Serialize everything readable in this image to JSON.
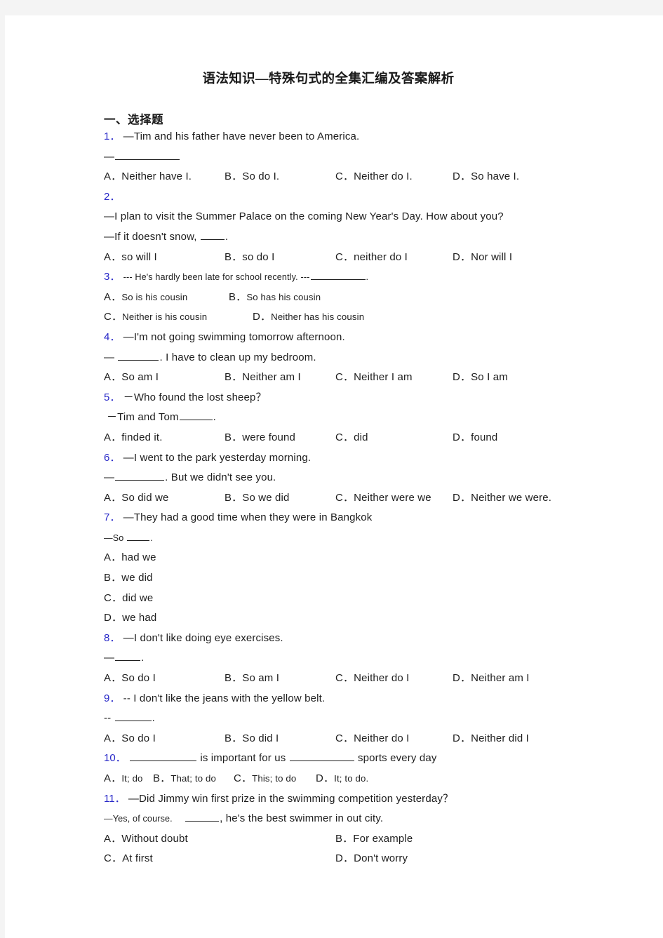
{
  "document": {
    "title": "语法知识—特殊句式的全集汇编及答案解析",
    "section_heading": "一、选择题"
  },
  "questions": [
    {
      "number": "1．",
      "stem": "—Tim and his father have never been to America.",
      "stem2_prefix": "—",
      "stem2_suffix": "",
      "options": [
        "A．Neither have I.",
        "B．So do I.",
        "C．Neither do I.",
        "D．So have I."
      ]
    },
    {
      "number": "2．",
      "line_a": "—I plan to visit the Summer Palace on the coming New Year's Day. How about you?",
      "line_b_prefix": "—If it doesn't snow, ",
      "line_b_suffix": ".",
      "options": [
        "A．so will I",
        "B．so do I",
        "C．neither do I",
        "D．Nor will I"
      ]
    },
    {
      "number": "3．",
      "stem_prefix": "--- He's hardly been late for school recently.    ---",
      "stem_suffix": ".",
      "options_row1": [
        "A．",
        "So is his cousin",
        "B．",
        "So has his cousin"
      ],
      "options_row2": [
        "C．",
        "Neither is his cousin",
        "D．",
        "Neither has his cousin"
      ]
    },
    {
      "number": "4．",
      "line_a": "—I'm not going swimming tomorrow afternoon.",
      "line_b_prefix": "— ",
      "line_b_suffix": ". I have to clean up my bedroom.",
      "options": [
        "A．So am I",
        "B．Neither am I",
        "C．Neither I am",
        "D．So I am"
      ]
    },
    {
      "number": "5．",
      "line_a": "－Who found the lost sheep？",
      "line_b_prefix": "－Tim and Tom",
      "line_b_suffix": ".",
      "options": [
        "A．finded it.",
        "B．were found",
        "C．did",
        "D．found"
      ]
    },
    {
      "number": "6．",
      "line_a": "—I went to the park yesterday morning.",
      "line_b_prefix": "—",
      "line_b_suffix": ". But we didn't see you.",
      "options": [
        "A．So did we",
        "B．So we did",
        "C．Neither were we",
        "D．Neither we were."
      ]
    },
    {
      "number": "7．",
      "line_a": "—They had a good time when they were in Bangkok",
      "line_b_prefix": "—So ",
      "line_b_suffix": ".",
      "stacked_options": [
        "A．had we",
        "B．we did",
        "C．did we",
        "D．we had"
      ]
    },
    {
      "number": "8．",
      "line_a": "—I don't like doing eye exercises.",
      "line_b_prefix": "—",
      "line_b_suffix": ".",
      "options": [
        "A．So do I",
        "B．So am I",
        "C．Neither do I",
        "D．Neither am I"
      ]
    },
    {
      "number": "9．",
      "line_a": "-- I don't like the jeans with the yellow belt.",
      "line_b_prefix": "-- ",
      "line_b_suffix": ".",
      "options": [
        "A．So do I",
        "B．So did I",
        "C．Neither do I",
        "D．Neither did I"
      ]
    },
    {
      "number": "10．",
      "stem_part1": " is important for us ",
      "stem_part2": " sports every day",
      "options": [
        "A．",
        "It; do",
        "B．",
        "That; to do",
        "C．",
        "This; to do",
        "D．",
        "It; to do."
      ]
    },
    {
      "number": "11．",
      "line_a": "—Did Jimmy win first prize in the swimming competition yesterday？",
      "line_b_prefix": "—Yes, of course.",
      "line_b_mid": "",
      "line_b_suffix": ", he's the best swimmer in out city.",
      "options_row1": [
        "A．Without doubt",
        "B．For example"
      ],
      "options_row2": [
        "C．At first",
        "D．Don't worry"
      ]
    }
  ],
  "colors": {
    "question_number": "#2828c8",
    "body_text": "#1d1d1d",
    "page_background": "#ffffff",
    "outer_background": "#f4f4f4"
  }
}
